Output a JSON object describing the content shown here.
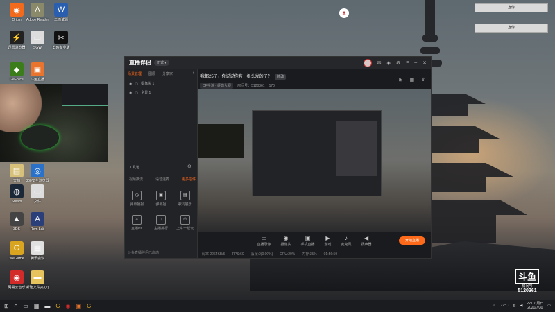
{
  "desktop": {
    "icons": [
      {
        "label": "Origin",
        "glyph": "◉",
        "color": "#f26b1d"
      },
      {
        "label": "Adobe Reader",
        "glyph": "A",
        "color": "#8a8a6a"
      },
      {
        "label": "二面试题",
        "glyph": "W",
        "color": "#2a5fb0"
      },
      {
        "label": "迅雷浏览器",
        "glyph": "⚡",
        "color": "#222"
      },
      {
        "label": "SGW",
        "glyph": "▭",
        "color": "#ddd"
      },
      {
        "label": "剪映专业版",
        "glyph": "✂",
        "color": "#111"
      },
      {
        "label": "GeForce",
        "glyph": "◆",
        "color": "#3a7d1a"
      },
      {
        "label": "斗鱼直播",
        "glyph": "▣",
        "color": "#e8742e"
      },
      {
        "label": "文档",
        "glyph": "▤",
        "color": "#d6c07a"
      },
      {
        "label": "360安全浏览器",
        "glyph": "◎",
        "color": "#2a72c9"
      },
      {
        "label": "Steam",
        "glyph": "◍",
        "color": "#1b2838"
      },
      {
        "label": "文件",
        "glyph": "▭",
        "color": "#ddd"
      },
      {
        "label": "3DS",
        "glyph": "▲",
        "color": "#444"
      },
      {
        "label": "Rem Lab",
        "glyph": "A",
        "color": "#2a3e7a"
      },
      {
        "label": "WeGame",
        "glyph": "G",
        "color": "#d9a521"
      },
      {
        "label": "腾讯会议",
        "glyph": "▤",
        "color": "#e0e0e0"
      },
      {
        "label": "网易云音乐",
        "glyph": "◉",
        "color": "#d32a2a"
      },
      {
        "label": "新建文件夹 (2)",
        "glyph": "▬",
        "color": "#e6c35c"
      }
    ],
    "top_right_buttons": [
      "宣传",
      "宣传"
    ]
  },
  "app": {
    "logo": "直播伴侣",
    "version": "正式 ▾",
    "left_tabs": [
      "场景管理",
      "图层",
      "分享家"
    ],
    "scenes": [
      "摄像头 1",
      "全景 1"
    ],
    "tools_header": "工具箱",
    "tool_tabs": [
      "视频推流",
      "语音连麦",
      "更多插件"
    ],
    "tools": [
      {
        "label": "弹幕播报",
        "glyph": "◷"
      },
      {
        "label": "弹幕姬",
        "glyph": "▣"
      },
      {
        "label": "歌词展示",
        "glyph": "▤"
      },
      {
        "label": "直播PK",
        "glyph": "⚔"
      },
      {
        "label": "主播排行",
        "glyph": "↓"
      },
      {
        "label": "上车一起玩",
        "glyph": "⚇"
      }
    ],
    "footer_text": "斗鱼直播伴侣已启动",
    "room_title": "我都25了，你说说你有一根头发的了？",
    "edit_label": "修改",
    "category": "CF手游 · 经典大赛",
    "room_info": "房间号：5120361",
    "heat": "170",
    "controls": [
      {
        "label": "直播录像",
        "glyph": "▭"
      },
      {
        "label": "摄像头",
        "glyph": "◉"
      },
      {
        "label": "手机直播",
        "glyph": "▣"
      },
      {
        "label": "游戏",
        "glyph": "▶"
      },
      {
        "label": "麦克风",
        "glyph": "♪"
      },
      {
        "label": "扬声器",
        "glyph": "◀"
      }
    ],
    "live_button": "开始直播",
    "status": [
      "码率 2264KB/S",
      "FPS:60",
      "丢帧:0(0.00%)",
      "CPU:20%",
      "内存:35%",
      "01:56:59"
    ]
  },
  "watermark": {
    "brand": "斗鱼",
    "room_label": "房间号",
    "room_number": "5120361"
  },
  "taskbar": {
    "time": "22:07 周日",
    "date": "2021/7/30",
    "temp": "27°C"
  },
  "colors": {
    "accent": "#ff6a1a",
    "app_bg": "#1d1e22"
  }
}
